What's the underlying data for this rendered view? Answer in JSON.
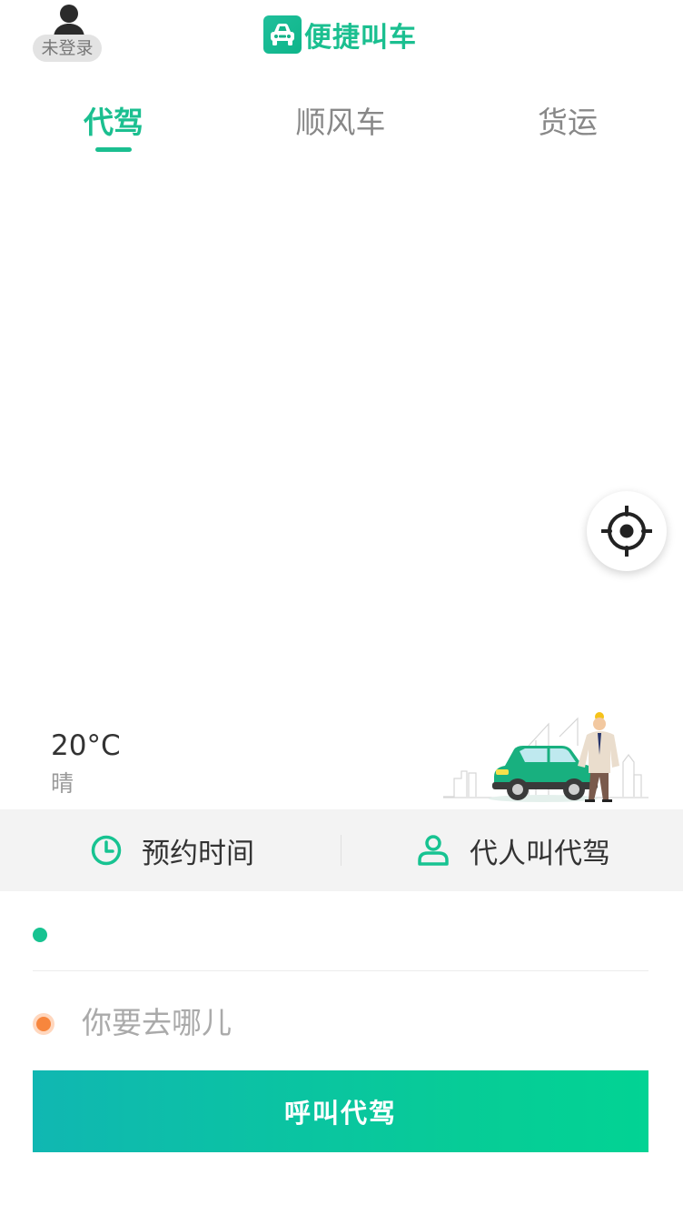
{
  "header": {
    "user_status": "未登录",
    "brand_name": "便捷叫车",
    "icons": {
      "user": "user-icon",
      "brand": "car-logo-icon"
    }
  },
  "tabs": [
    {
      "label": "代驾",
      "active": true
    },
    {
      "label": "顺风车",
      "active": false
    },
    {
      "label": "货运",
      "active": false
    }
  ],
  "map": {
    "locate_icon": "crosshair-icon"
  },
  "weather": {
    "temperature": "20°C",
    "condition": "晴"
  },
  "options": {
    "reserve": {
      "label": "预约时间",
      "icon": "clock-icon"
    },
    "proxy": {
      "label": "代人叫代驾",
      "icon": "person-icon"
    }
  },
  "addresses": {
    "from": {
      "value": "",
      "placeholder": ""
    },
    "to": {
      "value": "",
      "placeholder": "你要去哪儿"
    }
  },
  "call_button": {
    "label": "呼叫代驾"
  },
  "colors": {
    "accent": "#1bbf90",
    "origin_dot": "#17c391",
    "destination_dot": "#f7863d",
    "button_gradient_start": "#10b7b2",
    "button_gradient_end": "#02d394"
  }
}
